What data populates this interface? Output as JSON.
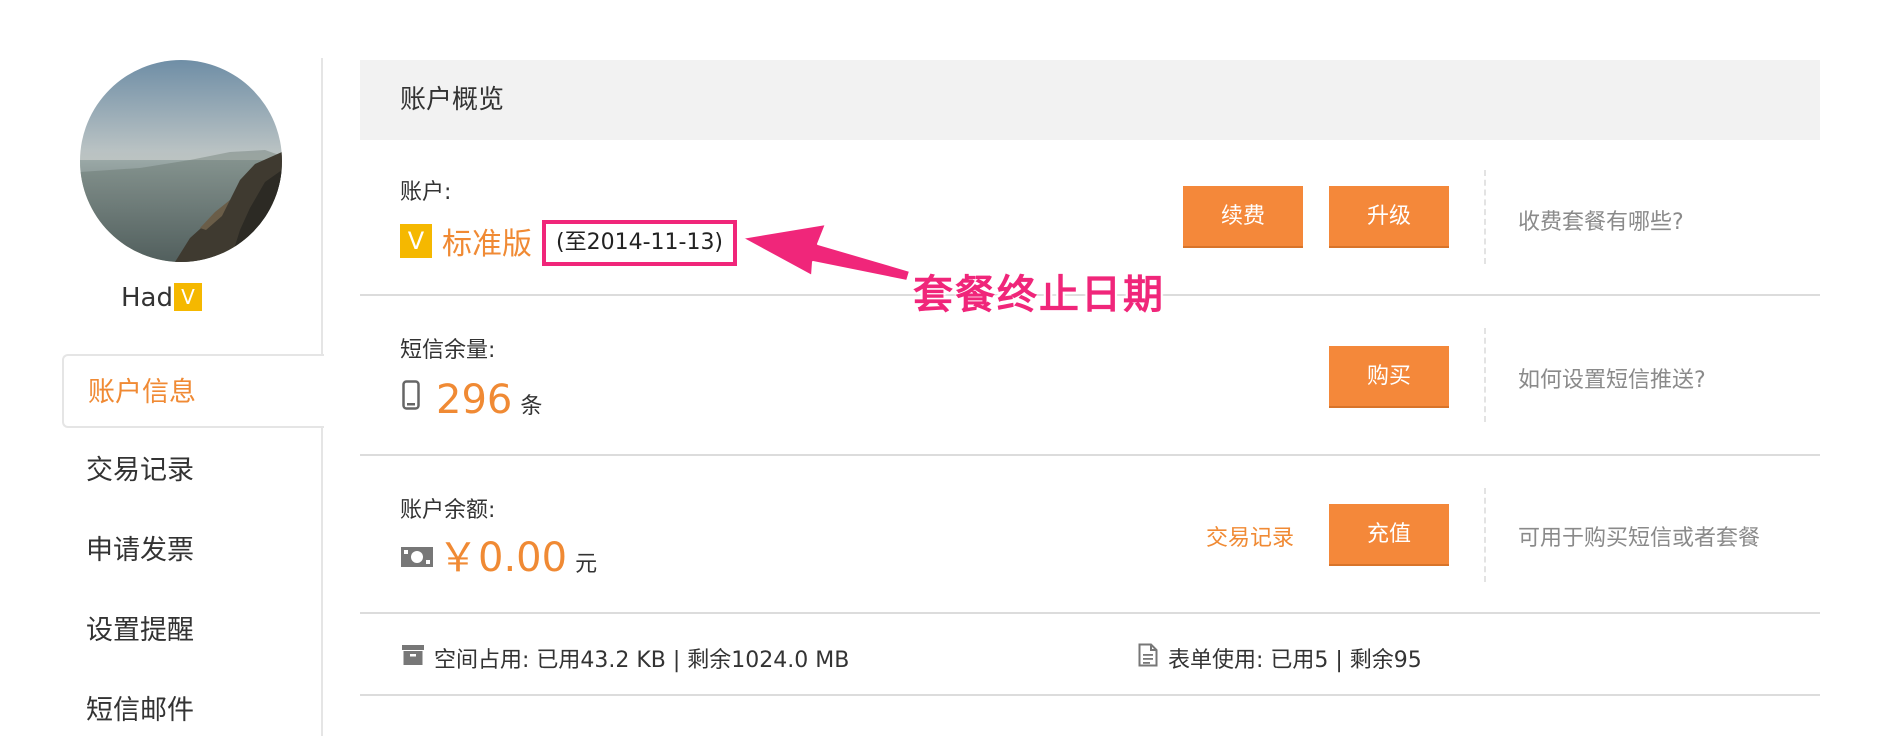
{
  "sidebar": {
    "user_name": "Had",
    "vip_badge": "V",
    "nav": [
      {
        "label": "账户信息",
        "active": true
      },
      {
        "label": "交易记录",
        "active": false
      },
      {
        "label": "申请发票",
        "active": false
      },
      {
        "label": "设置提醒",
        "active": false
      },
      {
        "label": "短信邮件",
        "active": false
      }
    ]
  },
  "panel": {
    "title": "账户概览"
  },
  "account": {
    "label": "账户:",
    "badge": "V",
    "plan": "标准版",
    "expiry": "(至2014-11-13)",
    "renew_button": "续费",
    "upgrade_button": "升级",
    "help_link": "收费套餐有哪些?"
  },
  "annotation": {
    "text": "套餐终止日期",
    "color": "#f0267a"
  },
  "sms": {
    "label": "短信余量:",
    "icon": "phone-icon",
    "count": "296",
    "unit": "条",
    "buy_button": "购买",
    "help_link": "如何设置短信推送?"
  },
  "balance": {
    "label": "账户余额:",
    "icon": "cash-icon",
    "amount": "￥0.00",
    "unit": "元",
    "transactions_link": "交易记录",
    "recharge_button": "充值",
    "help_link": "可用于购买短信或者套餐"
  },
  "usage": {
    "space_icon": "archive-icon",
    "space_text": "空间占用:  已用43.2 KB | 剩余1024.0 MB",
    "form_icon": "document-icon",
    "form_text": "表单使用:  已用5 | 剩余95"
  },
  "colors": {
    "accent": "#f4883a",
    "badge": "#f5b800",
    "annotation": "#f0267a"
  }
}
